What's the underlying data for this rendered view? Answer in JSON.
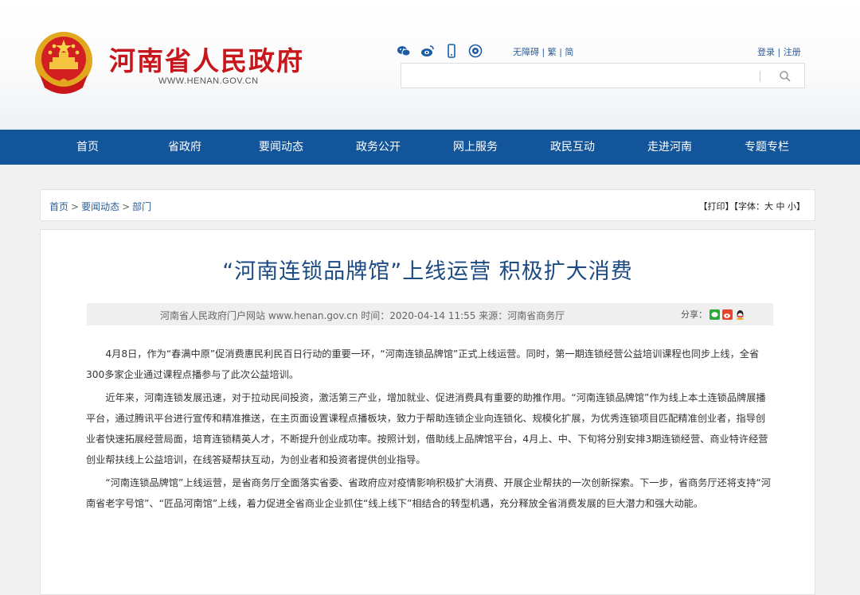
{
  "header": {
    "site_title": "河南省人民政府",
    "site_url": "WWW.HENAN.GOV.CN",
    "social_icons": [
      "wechat-icon",
      "weibo-icon",
      "mobile-icon",
      "app-icon"
    ],
    "accessibility": "无障碍 | 繁 | 简",
    "login": "登录 | 注册",
    "search_placeholder": ""
  },
  "nav": [
    "首页",
    "省政府",
    "要闻动态",
    "政务公开",
    "网上服务",
    "政民互动",
    "走进河南",
    "专题专栏"
  ],
  "breadcrumb": {
    "home": "首页",
    "level1": "要闻动态",
    "level2": "部门",
    "separator": ">",
    "tools": "【打印】【字体：大 中 小】"
  },
  "article": {
    "title": "“河南连锁品牌馆”上线运营 积极扩大消费",
    "meta": "河南省人民政府门户网站 www.henan.gov.cn    时间：2020-04-14 11:55    来源：河南省商务厅",
    "share_label": "分享：",
    "paragraphs": [
      "4月8日，作为“春满中原”促消费惠民利民百日行动的重要一环，“河南连锁品牌馆”正式上线运营。同时，第一期连锁经营公益培训课程也同步上线，全省300多家企业通过课程点播参与了此次公益培训。",
      "近年来，河南连锁发展迅速，对于拉动民间投资，激活第三产业，增加就业、促进消费具有重要的助推作用。“河南连锁品牌馆”作为线上本土连锁品牌展播平台，通过腾讯平台进行宣传和精准推送，在主页面设置课程点播板块，致力于帮助连锁企业向连锁化、规模化扩展，为优秀连锁项目匹配精准创业者，指导创业者快速拓展经营局面，培育连锁精英人才，不断提升创业成功率。按照计划，借助线上品牌馆平台，4月上、中、下旬将分别安排3期连锁经营、商业特许经营创业帮扶线上公益培训，在线答疑帮扶互动，为创业者和投资者提供创业指导。",
      "“河南连锁品牌馆”上线运营，是省商务厅全面落实省委、省政府应对疫情影响积极扩大消费、开展企业帮扶的一次创新探索。下一步，省商务厅还将支持“河南省老字号馆”、“匠品河南馆”上线，着力促进全省商业企业抓住“线上线下”相结合的转型机遇，充分释放全省消费发展的巨大潜力和强大动能。"
    ]
  },
  "colors": {
    "title_red": "#c8171c",
    "nav_blue": "#13559b",
    "link_blue": "#2f5e95",
    "article_title": "#1c4a82"
  }
}
